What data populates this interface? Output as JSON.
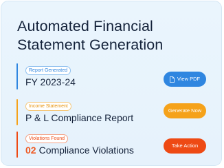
{
  "card": {
    "title_line1": "Automated Financial",
    "title_line2": "Statement Generation"
  },
  "rows": [
    {
      "chip": "Report Generated",
      "label": "FY 2023-24",
      "button": "View PDF",
      "button_icon": "document-icon",
      "color": "#2f86e0"
    },
    {
      "chip": "Income Statement",
      "label": "P & L Compliance Report",
      "button": "Generate Now",
      "color": "#f5a21a"
    },
    {
      "chip": "Violations Found",
      "count": "02",
      "label": "Compliance Violations",
      "button": "Take Action",
      "color": "#ee4a14"
    }
  ]
}
